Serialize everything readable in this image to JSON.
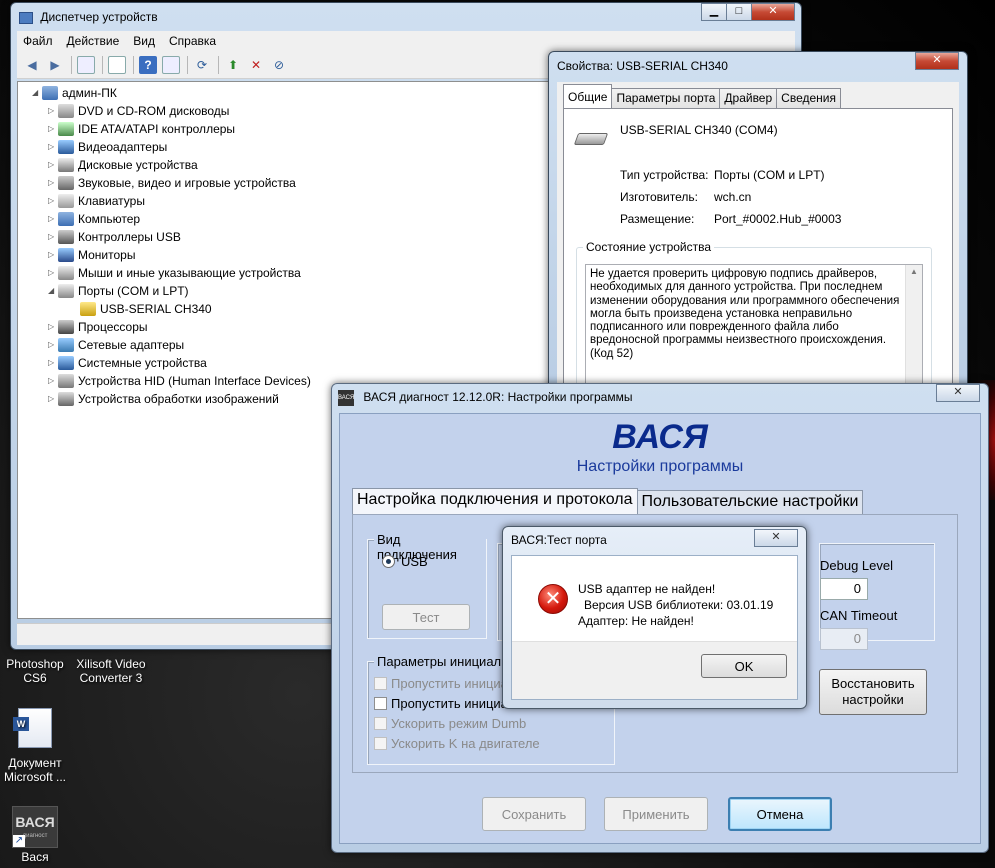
{
  "desktop": {
    "icons": [
      {
        "label_line1": "Photoshop",
        "label_line2": "CS6"
      },
      {
        "label_line1": "Xilisoft Video",
        "label_line2": "Converter 3"
      },
      {
        "label_line1": "Документ",
        "label_line2": "Microsoft ..."
      },
      {
        "label_line1": "Вася",
        "logo_text": "ВАСЯ",
        "logo_sub": "диагност"
      }
    ]
  },
  "device_manager": {
    "title": "Диспетчер устройств",
    "menu": [
      "Файл",
      "Действие",
      "Вид",
      "Справка"
    ],
    "root": "админ-ПК",
    "items": [
      {
        "label": "DVD и CD-ROM дисководы",
        "icon": "dvd-icon"
      },
      {
        "label": "IDE ATA/ATAPI контроллеры",
        "icon": "ide-icon"
      },
      {
        "label": "Видеоадаптеры",
        "icon": "display-adapter-icon"
      },
      {
        "label": "Дисковые устройства",
        "icon": "disk-icon"
      },
      {
        "label": "Звуковые, видео и игровые устройства",
        "icon": "sound-icon"
      },
      {
        "label": "Клавиатуры",
        "icon": "keyboard-icon"
      },
      {
        "label": "Компьютер",
        "icon": "computer-icon"
      },
      {
        "label": "Контроллеры USB",
        "icon": "usb-icon"
      },
      {
        "label": "Мониторы",
        "icon": "monitor-icon"
      },
      {
        "label": "Мыши и иные указывающие устройства",
        "icon": "mouse-icon"
      },
      {
        "label": "Порты (COM и LPT)",
        "icon": "port-icon",
        "expanded": true
      },
      {
        "label": "USB-SERIAL CH340",
        "icon": "warning-port-icon",
        "child": true
      },
      {
        "label": "Процессоры",
        "icon": "cpu-icon"
      },
      {
        "label": "Сетевые адаптеры",
        "icon": "network-icon"
      },
      {
        "label": "Системные устройства",
        "icon": "system-icon"
      },
      {
        "label": "Устройства HID (Human Interface Devices)",
        "icon": "hid-icon"
      },
      {
        "label": "Устройства обработки изображений",
        "icon": "camera-icon"
      }
    ]
  },
  "properties": {
    "title": "Свойства: USB-SERIAL CH340",
    "tabs": [
      "Общие",
      "Параметры порта",
      "Драйвер",
      "Сведения"
    ],
    "device_name": "USB-SERIAL CH340 (COM4)",
    "type_label": "Тип устройства:",
    "type_value": "Порты (COM и LPT)",
    "maker_label": "Изготовитель:",
    "maker_value": "wch.cn",
    "location_label": "Размещение:",
    "location_value": "Port_#0002.Hub_#0003",
    "status_title": "Состояние устройства",
    "status_text": "Не удается проверить цифровую подпись драйверов, необходимых для данного устройства. При последнем изменении оборудования или программного обеспечения могла быть произведена установка неправильно подписанного или поврежденного файла либо вредоносной программы неизвестного происхождения. (Код 52)"
  },
  "vasya": {
    "window_title": "ВАСЯ диагност 12.12.0R:  Настройки программы",
    "logo": "ВАСЯ",
    "heading": "ВАСЯ",
    "subheading": "Настройки программы",
    "tabs": [
      "Настройка подключения и протокола",
      "Пользовательские настройки"
    ],
    "connection_group": "Вид подключения",
    "usb_option": "USB",
    "test_button": "Тест",
    "init_group": "Параметры инициализ",
    "checks": [
      {
        "label": "Пропустить инициал",
        "checked": false,
        "disabled": true
      },
      {
        "label": "Пропустить инициал",
        "checked": false,
        "disabled": false
      },
      {
        "label": "Ускорить режим Dumb",
        "checked": false,
        "disabled": true
      },
      {
        "label": "Ускорить K на двигателе",
        "checked": false,
        "disabled": true
      }
    ],
    "debug_label": "Debug Level",
    "debug_value": "0",
    "can_label": "CAN Timeout",
    "can_value": "0",
    "restore_button_line1": "Восстановить",
    "restore_button_line2": "настройки",
    "save_button": "Сохранить",
    "apply_button": "Применить",
    "cancel_button": "Отмена"
  },
  "port_test": {
    "title": "ВАСЯ:Тест порта",
    "line1": "USB адаптер не найден!",
    "line2": "Версия USB библиотеки: 03.01.19",
    "line3": "Адаптер: Не найден!",
    "ok_button": "OK"
  },
  "colors": {
    "vasya_heading": "#0a2a8c",
    "vasya_panel": "#c3d2ec",
    "error_red": "#d4180c"
  }
}
